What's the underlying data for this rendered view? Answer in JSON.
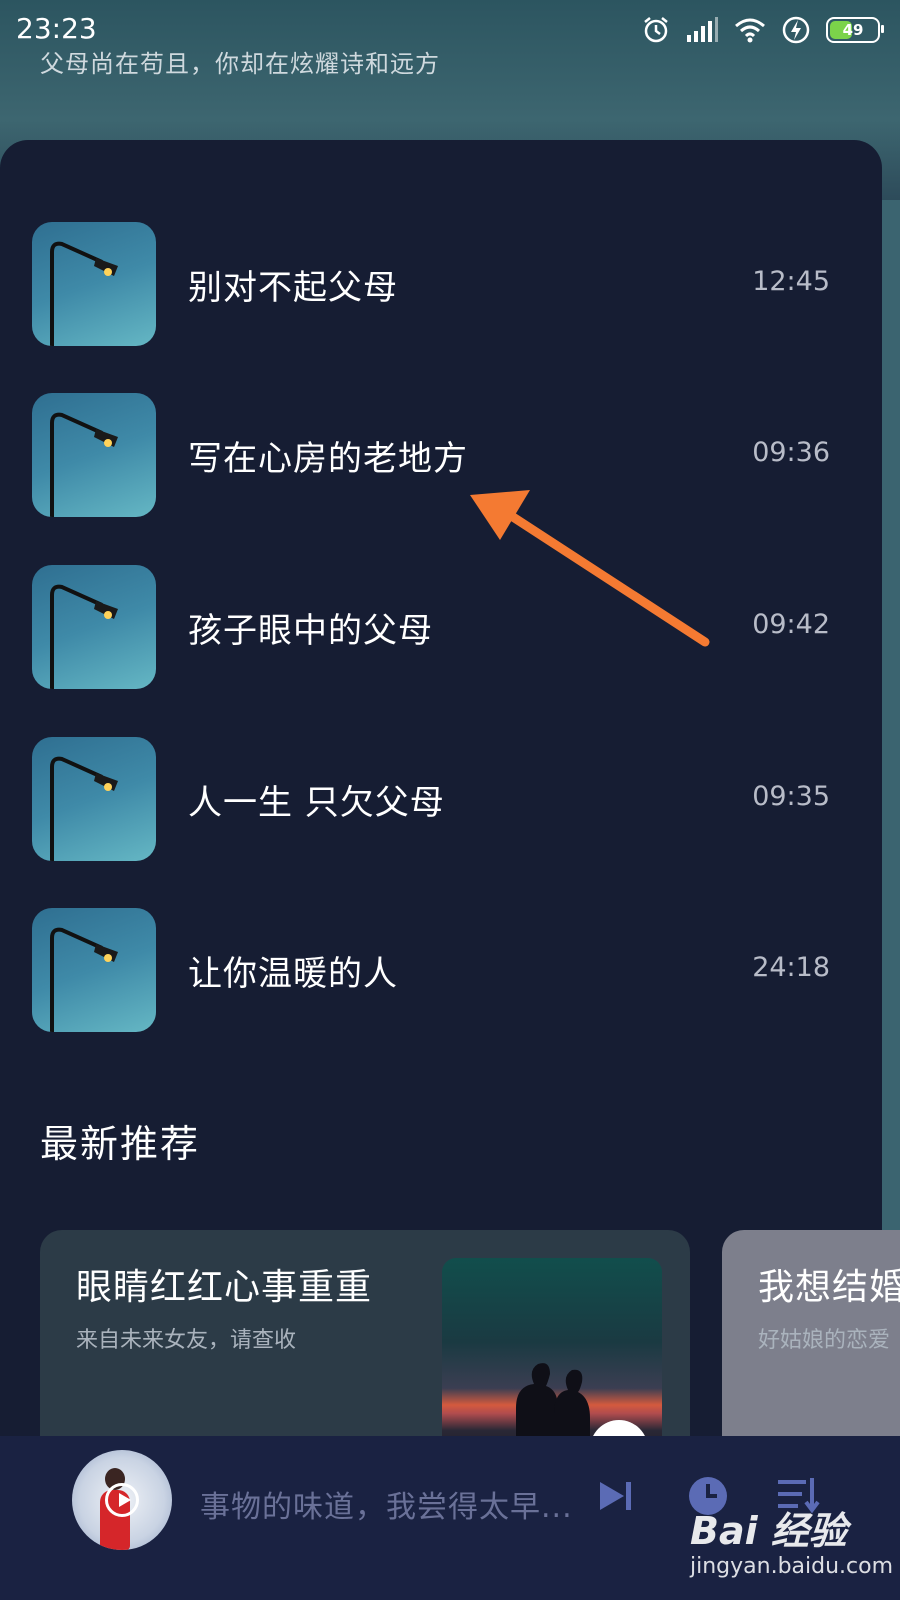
{
  "status_bar": {
    "time": "23:23",
    "battery": "49",
    "icons": [
      "alarm-icon",
      "signal-icon",
      "wifi-icon",
      "charging-icon",
      "battery-icon"
    ]
  },
  "header": {
    "subtitle": "父母尚在苟且，你却在炫耀诗和远方"
  },
  "tracks": [
    {
      "title": "别对不起父母",
      "duration": "12:45"
    },
    {
      "title": "写在心房的老地方",
      "duration": "09:36"
    },
    {
      "title": "孩子眼中的父母",
      "duration": "09:42"
    },
    {
      "title": "人一生 只欠父母",
      "duration": "09:35"
    },
    {
      "title": "让你温暖的人",
      "duration": "24:18"
    }
  ],
  "recommend": {
    "section_title": "最新推荐",
    "cards": [
      {
        "title": "眼睛红红心事重重",
        "subtitle": "来自未来女友，请查收"
      },
      {
        "title": "我想结婚",
        "subtitle": "好姑娘的恋爱"
      }
    ]
  },
  "player": {
    "now_playing": "事物的味道，我尝得太早..."
  },
  "watermark": {
    "logo": "Bai 经验",
    "url": "jingyan.baidu.com"
  },
  "colors": {
    "panel_bg": "#161d33",
    "player_bg": "#1a2242",
    "annotation_arrow": "#f47a32"
  }
}
